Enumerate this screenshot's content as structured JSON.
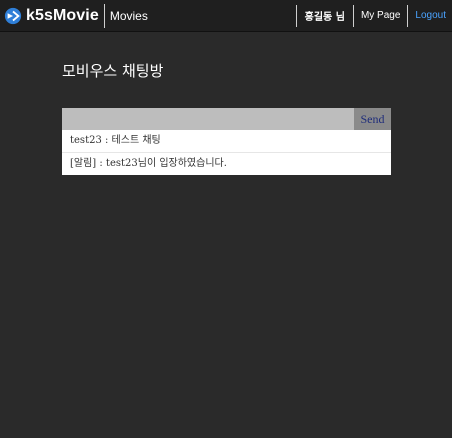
{
  "header": {
    "brand": "k5sMovie",
    "nav_movies": "Movies",
    "user": "홍길동 님",
    "mypage": "My Page",
    "logout": "Logout",
    "logo_icon": "k5s-logo-icon",
    "colors": {
      "bar": "#1f1f1f",
      "logout": "#4aa3ff",
      "background": "#2a2a2a"
    }
  },
  "page": {
    "title": "모비우스 채팅방"
  },
  "chat": {
    "input_value": "",
    "send_label": "Send",
    "messages": [
      "test23 : 테스트 채팅",
      "[알림] : test23님이 입장하였습니다."
    ]
  }
}
